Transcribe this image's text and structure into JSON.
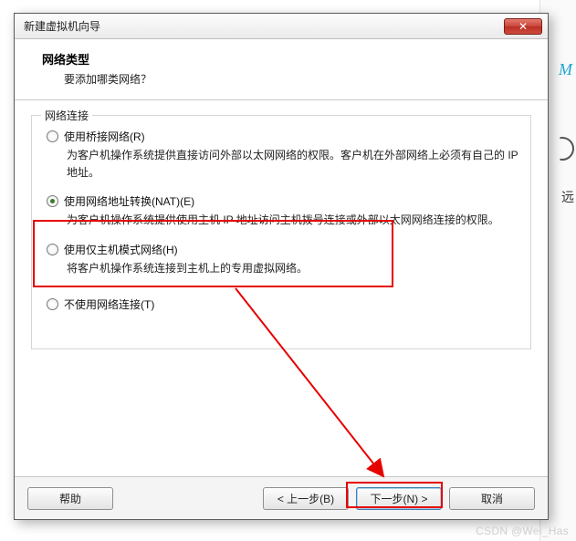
{
  "dialog": {
    "title": "新建虚拟机向导",
    "header_title": "网络类型",
    "header_sub": "要添加哪类网络？"
  },
  "group": {
    "legend": "网络连接"
  },
  "options": {
    "bridged": {
      "label": "使用桥接网络(R)",
      "desc": "为客户机操作系统提供直接访问外部以太网网络的权限。客户机在外部网络上必须有自己的 IP 地址。"
    },
    "nat": {
      "label": "使用网络地址转换(NAT)(E)",
      "desc": "为客户机操作系统提供使用主机 IP 地址访问主机拨号连接或外部以太网网络连接的权限。"
    },
    "hostonly": {
      "label": "使用仅主机模式网络(H)",
      "desc": "将客户机操作系统连接到主机上的专用虚拟网络。"
    },
    "none": {
      "label": "不使用网络连接(T)"
    }
  },
  "buttons": {
    "help": "帮助",
    "back": "< 上一步(B)",
    "next": "下一步(N) >",
    "cancel": "取消",
    "close": "✕"
  },
  "watermark": "CSDN @Wei_Has",
  "backdrop": {
    "m": "M",
    "txt": "远"
  }
}
